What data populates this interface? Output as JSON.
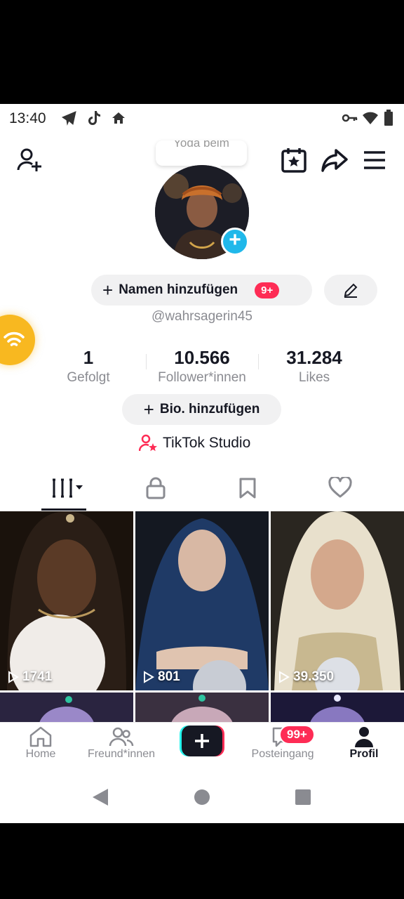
{
  "status_bar": {
    "time": "13:40"
  },
  "tooltip": {
    "text": "Yoda beim"
  },
  "profile": {
    "add_name_label": "Namen hinzufügen",
    "name_badge": "9+",
    "username": "@wahrsagerin45",
    "add_bio_label": "Bio. hinzufügen",
    "studio_label": "TikTok Studio"
  },
  "stats": [
    {
      "value": "1",
      "label": "Gefolgt"
    },
    {
      "value": "10.566",
      "label": "Follower*innen"
    },
    {
      "value": "31.284",
      "label": "Likes"
    }
  ],
  "tabs": [
    {
      "icon": "videos-grid-icon",
      "active": true
    },
    {
      "icon": "lock-icon",
      "active": false
    },
    {
      "icon": "bookmark-icon",
      "active": false
    },
    {
      "icon": "heart-icon",
      "active": false
    }
  ],
  "videos": [
    {
      "views": "1741"
    },
    {
      "views": "801"
    },
    {
      "views": "39.350"
    },
    {
      "views": ""
    },
    {
      "views": ""
    },
    {
      "views": ""
    }
  ],
  "bottom_nav": {
    "home": "Home",
    "friends": "Freund*innen",
    "inbox": "Posteingang",
    "inbox_badge": "99+",
    "profile": "Profil"
  },
  "colors": {
    "accent_red": "#fe2c55",
    "accent_cyan": "#20b8ea",
    "wifi_float": "#f8b820"
  }
}
